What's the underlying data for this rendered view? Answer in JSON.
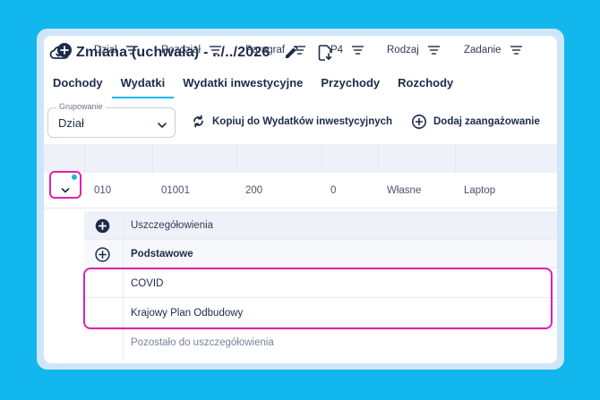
{
  "header": {
    "title": "Zmiana (uchwała) - ../../2026",
    "icons": [
      "cloud-check-icon",
      "pencil-icon",
      "file-export-icon"
    ]
  },
  "tabs": [
    {
      "label": "Dochody",
      "active": false
    },
    {
      "label": "Wydatki",
      "active": true
    },
    {
      "label": "Wydatki inwestycyjne",
      "active": false
    },
    {
      "label": "Przychody",
      "active": false
    },
    {
      "label": "Rozchody",
      "active": false
    }
  ],
  "grouping": {
    "legend": "Grupowanie",
    "value": "Dział"
  },
  "actions": {
    "copy_label": "Kopiuj do Wydatków inwestycyjnych",
    "add_label": "Dodaj zaangażowanie"
  },
  "table": {
    "columns": [
      "Dział",
      "Rozdział",
      "Paragraf",
      "P4",
      "Rodzaj",
      "Zadanie"
    ],
    "row": {
      "dzial": "010",
      "rozdzial": "01001",
      "paragraf": "200",
      "p4": "0",
      "rodzaj": "Własne",
      "zadanie": "Laptop"
    }
  },
  "details": {
    "header": "Uszczegółowienia",
    "group": "Podstawowe",
    "items": [
      "COVID",
      "Krajowy Plan Odbudowy"
    ],
    "remaining": "Pozostało do uszczegółowienia"
  },
  "colors": {
    "background": "#12b7ee",
    "accent": "#12b7ee",
    "highlight": "#e020b0",
    "navy": "#1d2a4a"
  }
}
